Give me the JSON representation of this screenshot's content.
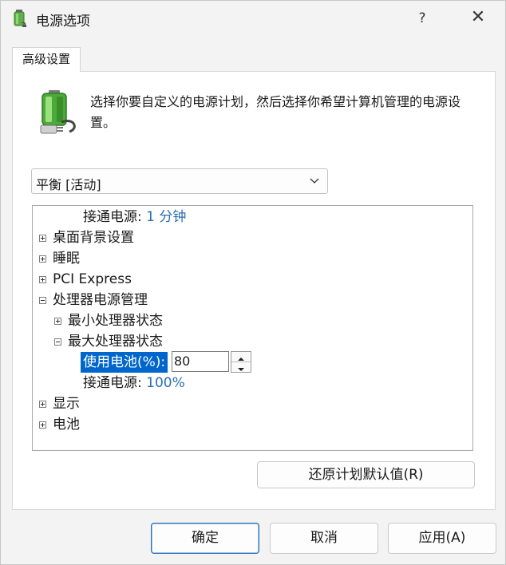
{
  "window": {
    "title": "电源选项",
    "help_label": "?",
    "close_label": "✕"
  },
  "tab": {
    "label": "高级设置"
  },
  "description": "选择你要自定义的电源计划，然后选择你希望计算机管理的电源设置。",
  "plan_select": {
    "value": "平衡 [活动]"
  },
  "tree": {
    "top_plugged": {
      "label": "接通电源:",
      "value": "1 分钟"
    },
    "desktop_bg": "桌面背景设置",
    "sleep": "睡眠",
    "pci": "PCI Express",
    "cpu_power": "处理器电源管理",
    "min_state": "最小处理器状态",
    "max_state": "最大处理器状态",
    "on_battery": {
      "label": "使用电池(%):",
      "value": "80"
    },
    "plugged_in": {
      "label": "接通电源:",
      "value": "100%"
    },
    "display": "显示",
    "battery": "电池"
  },
  "buttons": {
    "restore": "还原计划默认值(R)",
    "ok": "确定",
    "cancel": "取消",
    "apply": "应用(A)"
  },
  "colors": {
    "accent": "#0066cc",
    "value_text": "#2a6fb0"
  },
  "icons": {
    "app": "power-options-icon",
    "battery": "battery-plug-icon"
  }
}
